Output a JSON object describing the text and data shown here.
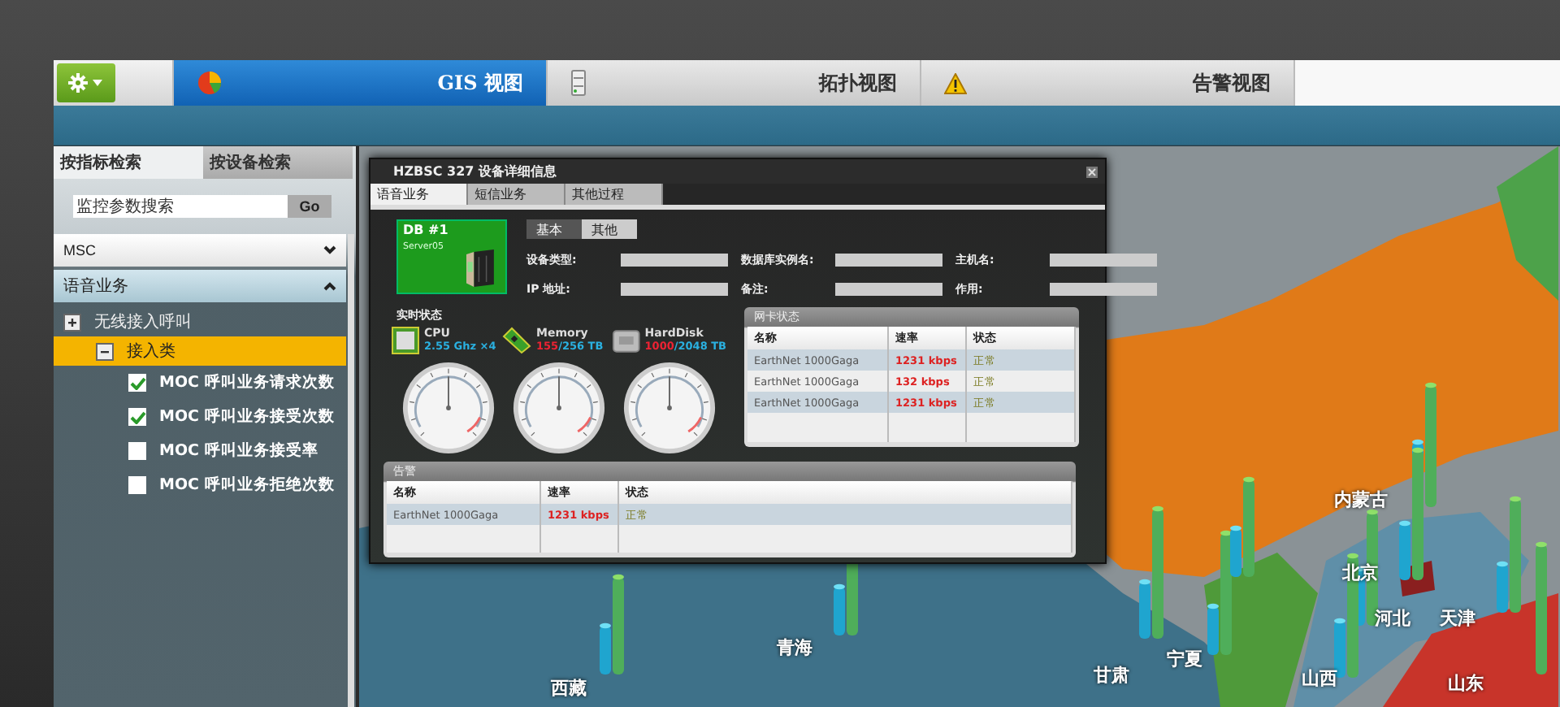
{
  "toolbar": {
    "tabs": [
      {
        "label": "GIS 视图",
        "selected": true,
        "kind": "pie"
      },
      {
        "label": "拓扑视图",
        "selected": false,
        "kind": "server"
      },
      {
        "label": "告警视图",
        "selected": false,
        "kind": "warning"
      }
    ]
  },
  "left_panel": {
    "tabs": [
      {
        "label": "按指标检索",
        "selected": true
      },
      {
        "label": "按设备检索",
        "selected": false
      }
    ],
    "search": {
      "placeholder": "监控参数搜索",
      "button": "Go"
    },
    "dropdown": "MSC",
    "accordion": {
      "label": "语音业务",
      "expanded": true
    },
    "tree": [
      {
        "label": "无线接入呼叫",
        "expanded": false,
        "selected": false,
        "children": [
          {
            "label": "接入类",
            "expanded": true,
            "selected": true,
            "items": [
              {
                "label": "MOC 呼叫业务请求次数",
                "checked": true
              },
              {
                "label": "MOC 呼叫业务接受次数",
                "checked": true
              },
              {
                "label": "MOC 呼叫业务接受率",
                "checked": false
              },
              {
                "label": "MOC 呼叫业务拒绝次数",
                "checked": false
              }
            ]
          }
        ]
      }
    ]
  },
  "map": {
    "labels": [
      "内蒙古",
      "北京",
      "河北",
      "天津",
      "山西",
      "山东",
      "宁夏",
      "甘肃",
      "青海",
      "西藏"
    ]
  },
  "dialog": {
    "title": "HZBSC 327 设备详细信息",
    "tabs": [
      {
        "label": "语音业务",
        "selected": true
      },
      {
        "label": "短信业务",
        "selected": false
      },
      {
        "label": "其他过程",
        "selected": false
      }
    ],
    "device": {
      "name": "DB #1",
      "subtitle": "Server05"
    },
    "subtabs": [
      {
        "label": "基本",
        "selected": true
      },
      {
        "label": "其他",
        "selected": false
      }
    ],
    "fields": [
      {
        "label": "设备类型:"
      },
      {
        "label": "数据库实例名:"
      },
      {
        "label": "主机名:"
      },
      {
        "label": "IP 地址:"
      },
      {
        "label": "备注:"
      },
      {
        "label": "作用:"
      }
    ],
    "realtime": {
      "title": "实时状态",
      "items": [
        {
          "kind": "cpu",
          "name": "CPU",
          "total": "2.55 Ghz ×4"
        },
        {
          "kind": "memory",
          "name": "Memory",
          "used": "155",
          "total": "/256 TB"
        },
        {
          "kind": "disk",
          "name": "HardDisk",
          "used": "1000",
          "total": "/2048 TB"
        }
      ]
    },
    "nic_table": {
      "title": "网卡状态",
      "columns": [
        "名称",
        "速率",
        "状态"
      ],
      "rows": [
        [
          "EarthNet 1000Gaga",
          "1231 kbps",
          "正常"
        ],
        [
          "EarthNet 1000Gaga",
          "132 kbps",
          "正常"
        ],
        [
          "EarthNet 1000Gaga",
          "1231 kbps",
          "正常"
        ]
      ]
    },
    "alarm_table": {
      "title": "告警",
      "columns": [
        "名称",
        "速率",
        "状态"
      ],
      "rows": [
        [
          "EarthNet 1000Gaga",
          "1231 kbps",
          "正常"
        ]
      ]
    }
  }
}
